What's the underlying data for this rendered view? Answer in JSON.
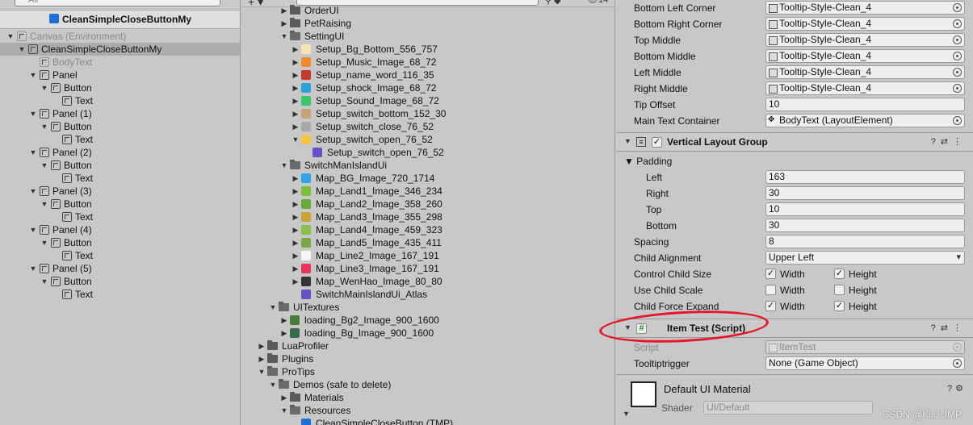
{
  "hierarchy": {
    "search_placeholder": "All",
    "scene_title": "CleanSimpleCloseButtonMy",
    "rows": [
      {
        "label": "Canvas (Environment)",
        "indent": 0,
        "arrow": "▼",
        "icon": true,
        "dim": true,
        "sel": false
      },
      {
        "label": "CleanSimpleCloseButtonMy",
        "indent": 1,
        "arrow": "▼",
        "icon": true,
        "dim": false,
        "sel": true
      },
      {
        "label": "BodyText",
        "indent": 2,
        "arrow": "",
        "icon": true,
        "dim": true,
        "sel": false
      },
      {
        "label": "Panel",
        "indent": 2,
        "arrow": "▼",
        "icon": true,
        "dim": false,
        "sel": false
      },
      {
        "label": "Button",
        "indent": 3,
        "arrow": "▼",
        "icon": true,
        "dim": false,
        "sel": false
      },
      {
        "label": "Text",
        "indent": 4,
        "arrow": "",
        "icon": true,
        "dim": false,
        "sel": false
      },
      {
        "label": "Panel (1)",
        "indent": 2,
        "arrow": "▼",
        "icon": true,
        "dim": false,
        "sel": false
      },
      {
        "label": "Button",
        "indent": 3,
        "arrow": "▼",
        "icon": true,
        "dim": false,
        "sel": false
      },
      {
        "label": "Text",
        "indent": 4,
        "arrow": "",
        "icon": true,
        "dim": false,
        "sel": false
      },
      {
        "label": "Panel (2)",
        "indent": 2,
        "arrow": "▼",
        "icon": true,
        "dim": false,
        "sel": false
      },
      {
        "label": "Button",
        "indent": 3,
        "arrow": "▼",
        "icon": true,
        "dim": false,
        "sel": false
      },
      {
        "label": "Text",
        "indent": 4,
        "arrow": "",
        "icon": true,
        "dim": false,
        "sel": false
      },
      {
        "label": "Panel (3)",
        "indent": 2,
        "arrow": "▼",
        "icon": true,
        "dim": false,
        "sel": false
      },
      {
        "label": "Button",
        "indent": 3,
        "arrow": "▼",
        "icon": true,
        "dim": false,
        "sel": false
      },
      {
        "label": "Text",
        "indent": 4,
        "arrow": "",
        "icon": true,
        "dim": false,
        "sel": false
      },
      {
        "label": "Panel (4)",
        "indent": 2,
        "arrow": "▼",
        "icon": true,
        "dim": false,
        "sel": false
      },
      {
        "label": "Button",
        "indent": 3,
        "arrow": "▼",
        "icon": true,
        "dim": false,
        "sel": false
      },
      {
        "label": "Text",
        "indent": 4,
        "arrow": "",
        "icon": true,
        "dim": false,
        "sel": false
      },
      {
        "label": "Panel (5)",
        "indent": 2,
        "arrow": "▼",
        "icon": true,
        "dim": false,
        "sel": false
      },
      {
        "label": "Button",
        "indent": 3,
        "arrow": "▼",
        "icon": true,
        "dim": false,
        "sel": false
      },
      {
        "label": "Text",
        "indent": 4,
        "arrow": "",
        "icon": true,
        "dim": false,
        "sel": false
      }
    ]
  },
  "project": {
    "count": "14",
    "rows": [
      {
        "label": "OrderUI",
        "indent": 3,
        "arrow": "▶",
        "kind": "folder"
      },
      {
        "label": "PetRaising",
        "indent": 3,
        "arrow": "▶",
        "kind": "folder"
      },
      {
        "label": "SettingUI",
        "indent": 3,
        "arrow": "▼",
        "kind": "folder-open"
      },
      {
        "label": "Setup_Bg_Bottom_556_757",
        "indent": 4,
        "arrow": "▶",
        "kind": "sprite",
        "color": "#f3e3b5"
      },
      {
        "label": "Setup_Music_Image_68_72",
        "indent": 4,
        "arrow": "▶",
        "kind": "sprite",
        "color": "#f08a2a"
      },
      {
        "label": "Setup_name_word_116_35",
        "indent": 4,
        "arrow": "▶",
        "kind": "sprite",
        "color": "#c0392b"
      },
      {
        "label": "Setup_shock_Image_68_72",
        "indent": 4,
        "arrow": "▶",
        "kind": "sprite",
        "color": "#2aa3d8"
      },
      {
        "label": "Setup_Sound_Image_68_72",
        "indent": 4,
        "arrow": "▶",
        "kind": "sprite",
        "color": "#3cc46a"
      },
      {
        "label": "Setup_switch_bottom_152_30",
        "indent": 4,
        "arrow": "▶",
        "kind": "sprite",
        "color": "#c8a27a"
      },
      {
        "label": "Setup_switch_close_76_52",
        "indent": 4,
        "arrow": "▶",
        "kind": "sprite",
        "color": "#a9a9a9"
      },
      {
        "label": "Setup_switch_open_76_52",
        "indent": 4,
        "arrow": "▼",
        "kind": "sprite",
        "color": "#f5c542"
      },
      {
        "label": "Setup_switch_open_76_52",
        "indent": 5,
        "arrow": "",
        "kind": "sprite",
        "color": "#6a4fc7"
      },
      {
        "label": "SwitchManIslandUi",
        "indent": 3,
        "arrow": "▼",
        "kind": "folder-open"
      },
      {
        "label": "Map_BG_Image_720_1714",
        "indent": 4,
        "arrow": "▶",
        "kind": "sprite",
        "color": "#2fa7e6"
      },
      {
        "label": "Map_Land1_Image_346_234",
        "indent": 4,
        "arrow": "▶",
        "kind": "sprite",
        "color": "#7bbf3a"
      },
      {
        "label": "Map_Land2_Image_358_260",
        "indent": 4,
        "arrow": "▶",
        "kind": "sprite",
        "color": "#6aa83a"
      },
      {
        "label": "Map_Land3_Image_355_298",
        "indent": 4,
        "arrow": "▶",
        "kind": "sprite",
        "color": "#c9a23a"
      },
      {
        "label": "Map_Land4_Image_459_323",
        "indent": 4,
        "arrow": "▶",
        "kind": "sprite",
        "color": "#8abf4a"
      },
      {
        "label": "Map_Land5_Image_435_411",
        "indent": 4,
        "arrow": "▶",
        "kind": "sprite",
        "color": "#7aa84a"
      },
      {
        "label": "Map_Line2_Image_167_191",
        "indent": 4,
        "arrow": "▶",
        "kind": "sprite",
        "color": "#f5f5f5"
      },
      {
        "label": "Map_Line3_Image_167_191",
        "indent": 4,
        "arrow": "▶",
        "kind": "sprite",
        "color": "#e8345a"
      },
      {
        "label": "Map_WenHao_Image_80_80",
        "indent": 4,
        "arrow": "▶",
        "kind": "sprite",
        "color": "#333333"
      },
      {
        "label": "SwitchMainIslandUi_Atlas",
        "indent": 4,
        "arrow": "",
        "kind": "sprite",
        "color": "#6a4fc7"
      },
      {
        "label": "UITextures",
        "indent": 2,
        "arrow": "▼",
        "kind": "folder-open"
      },
      {
        "label": "loading_Bg2_Image_900_1600",
        "indent": 3,
        "arrow": "▶",
        "kind": "sprite",
        "color": "#4a7a3a"
      },
      {
        "label": "loading_Bg_Image_900_1600",
        "indent": 3,
        "arrow": "▶",
        "kind": "sprite",
        "color": "#3a6a4a"
      },
      {
        "label": "LuaProfiler",
        "indent": 1,
        "arrow": "▶",
        "kind": "folder"
      },
      {
        "label": "Plugins",
        "indent": 1,
        "arrow": "▶",
        "kind": "folder"
      },
      {
        "label": "ProTips",
        "indent": 1,
        "arrow": "▼",
        "kind": "folder-open"
      },
      {
        "label": "Demos (safe to delete)",
        "indent": 2,
        "arrow": "▼",
        "kind": "folder-open"
      },
      {
        "label": "Materials",
        "indent": 3,
        "arrow": "▶",
        "kind": "folder"
      },
      {
        "label": "Resources",
        "indent": 3,
        "arrow": "▼",
        "kind": "folder-open"
      },
      {
        "label": "CleanSimpleCloseButton (TMP)",
        "indent": 4,
        "arrow": "",
        "kind": "sprite",
        "color": "#1e6fd6"
      }
    ]
  },
  "inspector": {
    "tooltip_fields": [
      {
        "label": "Bottom Left Corner",
        "value": "Tooltip-Style-Clean_4"
      },
      {
        "label": "Bottom Right Corner",
        "value": "Tooltip-Style-Clean_4"
      },
      {
        "label": "Top Middle",
        "value": "Tooltip-Style-Clean_4"
      },
      {
        "label": "Bottom Middle",
        "value": "Tooltip-Style-Clean_4"
      },
      {
        "label": "Left Middle",
        "value": "Tooltip-Style-Clean_4"
      },
      {
        "label": "Right Middle",
        "value": "Tooltip-Style-Clean_4"
      }
    ],
    "tip_offset_label": "Tip Offset",
    "tip_offset_value": "10",
    "main_text_label": "Main Text Container",
    "main_text_value": "BodyText (LayoutElement)",
    "vlg": {
      "title": "Vertical Layout Group",
      "padding_label": "Padding",
      "left_label": "Left",
      "left_value": "163",
      "right_label": "Right",
      "right_value": "30",
      "top_label": "Top",
      "top_value": "10",
      "bottom_label": "Bottom",
      "bottom_value": "30",
      "spacing_label": "Spacing",
      "spacing_value": "8",
      "alignment_label": "Child Alignment",
      "alignment_value": "Upper Left",
      "control_label": "Control Child Size",
      "scale_label": "Use Child Scale",
      "expand_label": "Child Force Expand",
      "width_label": "Width",
      "height_label": "Height",
      "control_width": true,
      "control_height": true,
      "scale_width": false,
      "scale_height": false,
      "expand_width": true,
      "expand_height": true
    },
    "item_test": {
      "title": "Item Test (Script)",
      "script_label": "Script",
      "script_value": "ItemTest",
      "tooltiptrigger_label": "Tooltiptrigger",
      "tooltiptrigger_value": "None (Game Object)"
    },
    "material": {
      "name": "Default UI Material",
      "shader_label": "Shader",
      "shader_value": "UI/Default"
    }
  },
  "watermark": "CSDN @KillJUMP",
  "colors": {
    "annotation_circle": "#e8142a",
    "selected_row": "#adadad",
    "cube_blue": "#1e6fd6"
  }
}
